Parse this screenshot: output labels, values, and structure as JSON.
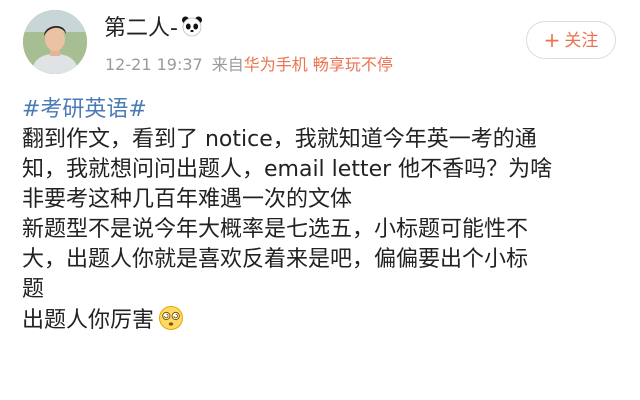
{
  "post": {
    "author": {
      "name": "第二人-",
      "name_emoji": "panda-face-emoji"
    },
    "meta": {
      "time": "12-21 19:37",
      "source_prefix": "来自",
      "source_device": "华为手机 畅享玩不停"
    },
    "follow_button": {
      "icon": "plus-icon",
      "plus": "+",
      "label": "关注"
    },
    "content": {
      "hashtag": "#考研英语#",
      "lines": [
        "翻到作文，看到了 notice，我就知道今年英一考的通",
        "知，我就想问问出题人，email letter 他不香吗？为啥",
        "非要考这种几百年难遇一次的文体",
        "新题型不是说今年大概率是七选五，小标题可能性不",
        "大，出题人你就是喜欢反着来是吧，偏偏要出个小标",
        "题",
        "出题人你厉害"
      ],
      "end_emoji": "dizzy-face-emoji"
    },
    "colors": {
      "hashtag": "#4b7bb6",
      "accent": "#eb7350",
      "meta_gray": "#9a9a9a"
    }
  }
}
